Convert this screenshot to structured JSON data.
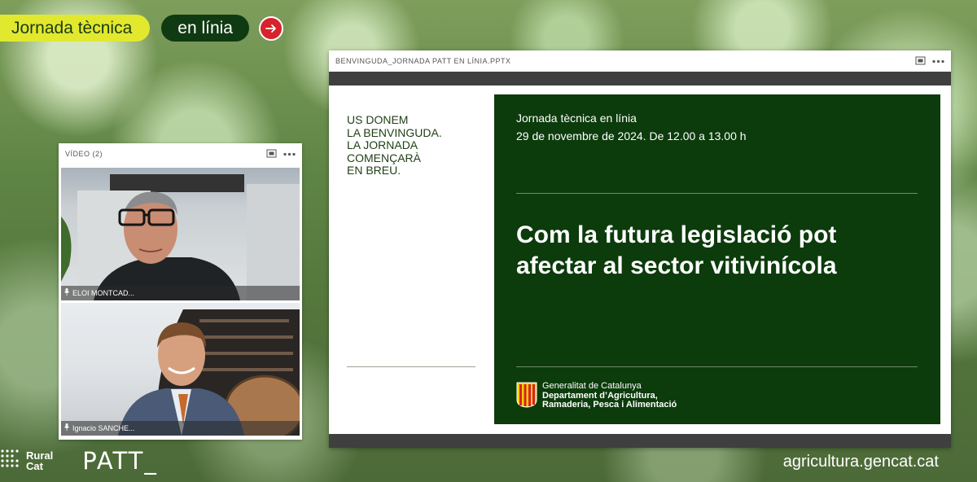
{
  "header": {
    "title": "Jornada tècnica",
    "mode": "en línia",
    "arrow_icon": "arrow-right-icon"
  },
  "video_panel": {
    "title": "VÍDEO (2)",
    "participants": [
      {
        "name": "ELOI MONTCAD..."
      },
      {
        "name": "Ignacio SANCHE..."
      }
    ]
  },
  "slide_window": {
    "filename": "BENVINGUDA_JORNADA PATT EN LÍNIA.PPTX",
    "welcome_lines": [
      "US DONEM",
      "LA BENVINGUDA.",
      "LA JORNADA",
      "COMENÇARÀ",
      "EN BREU."
    ],
    "event_type": "Jornada tècnica en línia",
    "event_date": "29 de novembre de 2024. De 12.00 a 13.00 h",
    "headline_lines": [
      "Com la futura legislació pot",
      "afectar al sector vitivinícola"
    ],
    "org_lines": [
      "Generalitat de Catalunya",
      "Departament d’Agricultura,",
      "Ramaderia, Pesca i Alimentació"
    ]
  },
  "footer": {
    "rural_line1": "Rural",
    "rural_line2": "Cat",
    "patt": "PATT_",
    "domain": "agricultura.gencat.cat"
  },
  "colors": {
    "accent_yellow": "#e2e82e",
    "dark_green": "#0c3b0c",
    "red": "#d7232c"
  }
}
